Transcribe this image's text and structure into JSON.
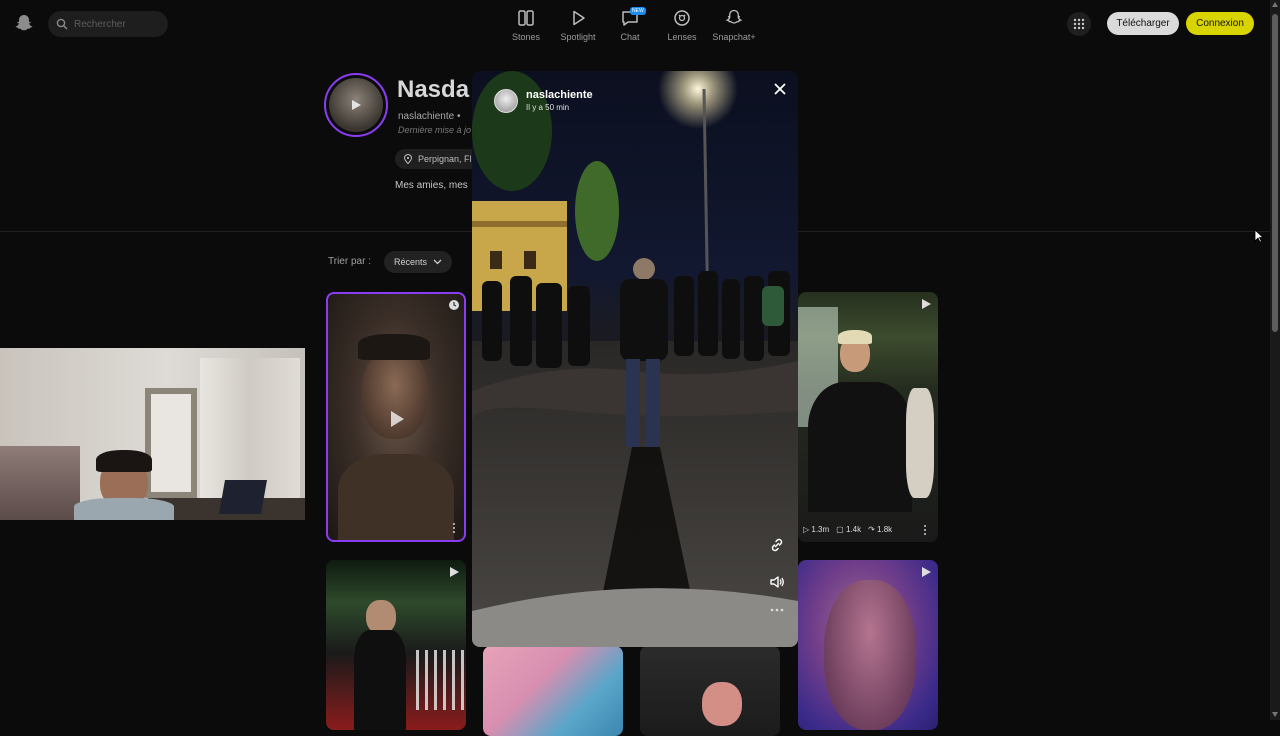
{
  "header": {
    "search_placeholder": "Rechercher",
    "nav": [
      {
        "label": "Stones",
        "icon": "stories-icon"
      },
      {
        "label": "Spotlight",
        "icon": "play-icon"
      },
      {
        "label": "Chat",
        "icon": "chat-icon",
        "badge": "NEW"
      },
      {
        "label": "Lenses",
        "icon": "lenses-icon"
      },
      {
        "label": "Snapchat+",
        "icon": "snapchat-plus-icon"
      }
    ],
    "download_label": "Télécharger",
    "login_label": "Connexion"
  },
  "profile": {
    "name": "Nasda",
    "handle": "naslachiente",
    "handle_sep": "•",
    "updated": "Dernière mise à jo",
    "location": "Perpignan, Fl",
    "bio": "Mes amies, mes"
  },
  "sort": {
    "label": "Trier par :",
    "value": "Récents"
  },
  "tiles": {
    "stats_1": {
      "views": "1.3m",
      "comments": "1.4k",
      "shares": "1.8k"
    }
  },
  "modal": {
    "username": "naslachiente",
    "time": "Il y a 50 min"
  },
  "colors": {
    "accent_purple": "#8a3df0",
    "login_yellow": "#d8d400",
    "background": "#0b0b0b"
  }
}
